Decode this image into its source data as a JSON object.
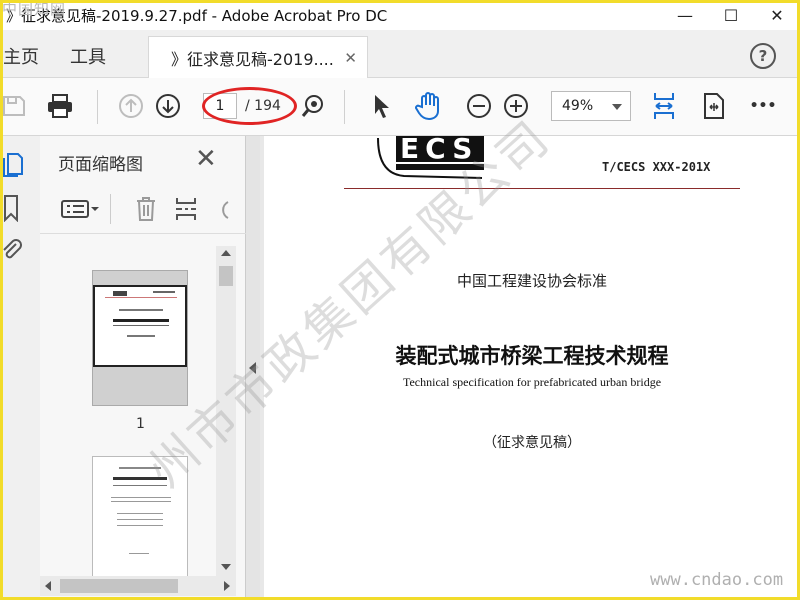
{
  "window": {
    "title": "》征求意见稿-2019.9.27.pdf - Adobe Acrobat Pro DC",
    "minimize": "—",
    "maximize": "☐",
    "close": "✕",
    "watermark_topleft": "中国知网"
  },
  "tabs": {
    "home": "主页",
    "tools": "工具",
    "document": "》征求意见稿-2019....",
    "document_close": "✕",
    "help": "?"
  },
  "toolbar": {
    "current_page": "1",
    "total_pages": "/ 194",
    "zoom": "49%",
    "more": "•••"
  },
  "thumbnail_panel": {
    "title": "页面缩略图",
    "close": "✕",
    "page1_label": "1"
  },
  "document": {
    "logo_text": "ECS",
    "standard_code": "T/CECS XXX-201X",
    "association": "中国工程建设协会标准",
    "title_zh": "装配式城市桥梁工程技术规程",
    "title_en": "Technical specification for prefabricated urban bridge",
    "draft_note": "（征求意见稿）"
  },
  "watermarks": {
    "diagonal": "州市市政集团有限公司",
    "bottom_right": "www.cndao.com"
  },
  "colors": {
    "frame": "#f2dc2a",
    "accent_blue": "#1a6fd1",
    "annotation_red": "#e02424"
  }
}
